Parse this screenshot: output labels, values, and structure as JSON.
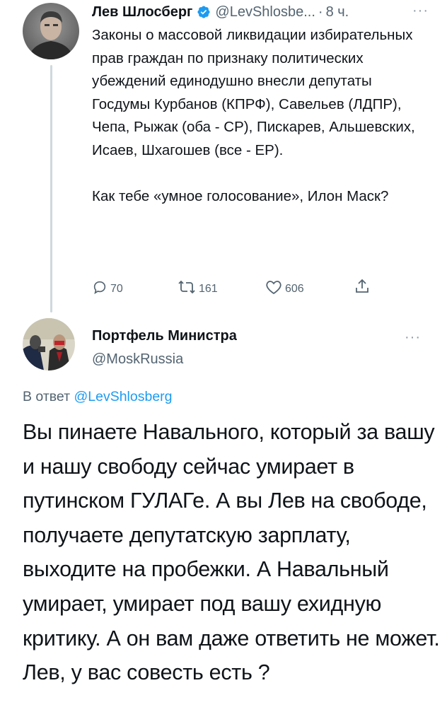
{
  "tweet1": {
    "author_name": "Лев Шлосберг",
    "handle": "@LevShlosbe...",
    "separator": "·",
    "time": "8 ч.",
    "more": "···",
    "text_paragraph_1": "Законы о массовой ликвидации избирательных прав граждан по признаку политических убеждений единодушно внесли депутаты Госдумы Курбанов (КПРФ), Савельев (ЛДПР), Чепа, Рыжак (оба - СР), Пискарев, Альшевских, Исаев, Шхагошев (все - ЕР).",
    "text_paragraph_2": "Как тебе «умное голосование», Илон Маск?",
    "replies": "70",
    "retweets": "161",
    "likes": "606"
  },
  "tweet2": {
    "author_name": "Портфель Министра",
    "handle": "@MoskRussia",
    "more": "···",
    "reply_prefix": "В ответ ",
    "reply_handle": "@LevShlosberg",
    "text": "Вы пинаете Навального, который за вашу и нашу свободу сейчас умирает в путинском ГУЛАГе. А вы Лев на свободе, получаете депутатскую зарплату, выходите на пробежки. А Навальный умирает, умирает под вашу ехидную критику. А он вам даже ответить не может. Лев, у вас совесть есть ?"
  },
  "icons": [
    "reply-icon",
    "retweet-icon",
    "like-icon",
    "share-icon",
    "verified-badge-icon",
    "more-icon"
  ],
  "colors": {
    "text": "#0f1419",
    "secondary": "#536471",
    "link": "#1d9bf0",
    "verified": "#1d9bf0",
    "thread_line": "#cfd9de"
  }
}
